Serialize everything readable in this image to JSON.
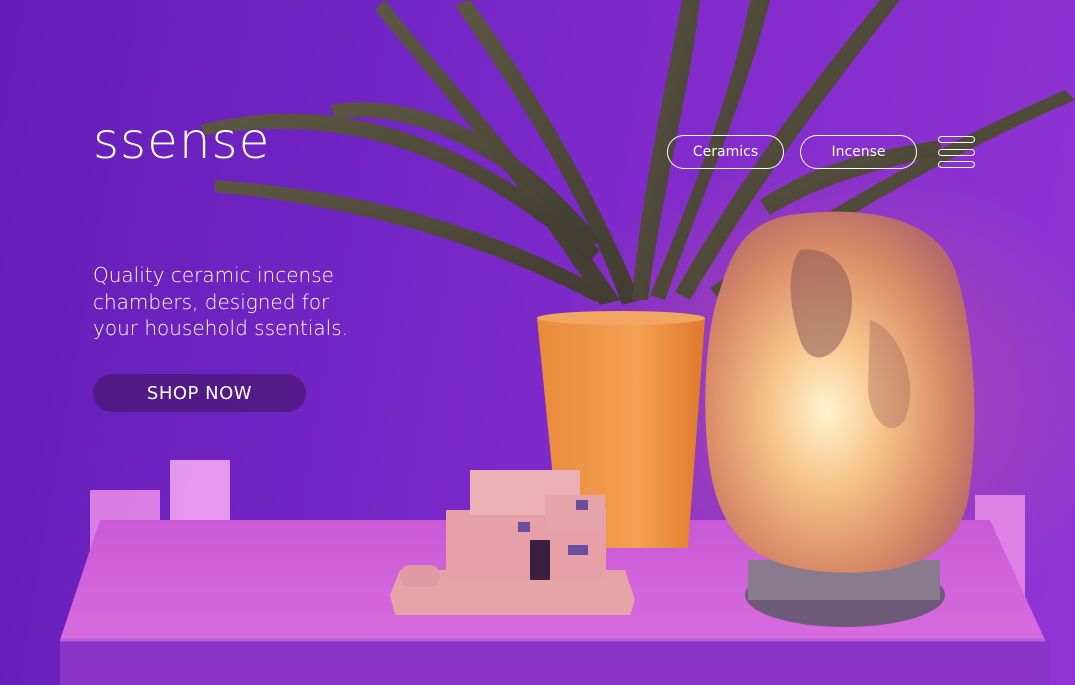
{
  "header": {
    "brand": "ssense",
    "nav": [
      {
        "label": "Ceramics"
      },
      {
        "label": "Incense"
      }
    ],
    "menu_icon": "hamburger-menu-icon"
  },
  "hero": {
    "tagline_lines": [
      "Quality ceramic incense",
      "chambers, designed for",
      "your household ssentials."
    ],
    "cta_label": "SHOP NOW"
  },
  "colors": {
    "background_purple": "#7a2ad0",
    "text": "#ffffff",
    "cta_bg": "#3c145a",
    "lamp_glow": "#ffb070"
  }
}
